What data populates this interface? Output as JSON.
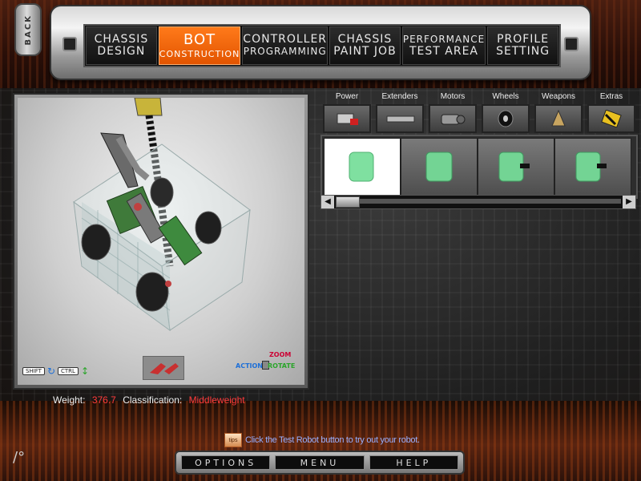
{
  "back_button": {
    "label": "BACK"
  },
  "nav": {
    "tabs": [
      {
        "line1": "CHASSIS",
        "line2": "DESIGN",
        "active": false
      },
      {
        "line1": "BOT",
        "line2": "CONSTRUCTION",
        "active": true
      },
      {
        "line1": "CONTROLLER",
        "line2": "PROGRAMMING",
        "active": false
      },
      {
        "line1": "CHASSIS",
        "line2": "PAINT JOB",
        "active": false
      },
      {
        "line1": "PERFORMANCE",
        "line2": "TEST AREA",
        "active": false
      },
      {
        "line1": "PROFILE",
        "line2": "SETTING",
        "active": false
      }
    ]
  },
  "viewport": {
    "shift_key": "SHIFT",
    "ctrl_key": "CTRL",
    "legend": {
      "zoom": "ZOOM",
      "action": "ACTION",
      "rotate": "ROTATE"
    }
  },
  "categories": [
    {
      "label": "Power",
      "icon": "battery-icon"
    },
    {
      "label": "Extenders",
      "icon": "extender-bar-icon"
    },
    {
      "label": "Motors",
      "icon": "motor-icon"
    },
    {
      "label": "Wheels",
      "icon": "wheel-icon"
    },
    {
      "label": "Weapons",
      "icon": "spike-weapon-icon"
    },
    {
      "label": "Extras",
      "icon": "hazard-extra-icon"
    }
  ],
  "parts": [
    {
      "icon": "green-battery-icon",
      "selected": true
    },
    {
      "icon": "green-battery-icon",
      "selected": false
    },
    {
      "icon": "green-battery-icon",
      "selected": false
    },
    {
      "icon": "green-battery-icon",
      "selected": false
    }
  ],
  "stats": {
    "weight_label": "Weight:",
    "weight_value": "376.7",
    "class_label": "Classification:",
    "class_value": "Middleweight"
  },
  "tip": {
    "icon_label": "tips",
    "text": "Click the Test Robot button to try out your robot."
  },
  "bottom_nav": {
    "options": "OPTIONS",
    "menu": "MENU",
    "help": "HELP"
  },
  "colors": {
    "accent": "#ff7a1a",
    "stat_value": "#ff3b3b",
    "tip_text": "#9ab0ff"
  }
}
